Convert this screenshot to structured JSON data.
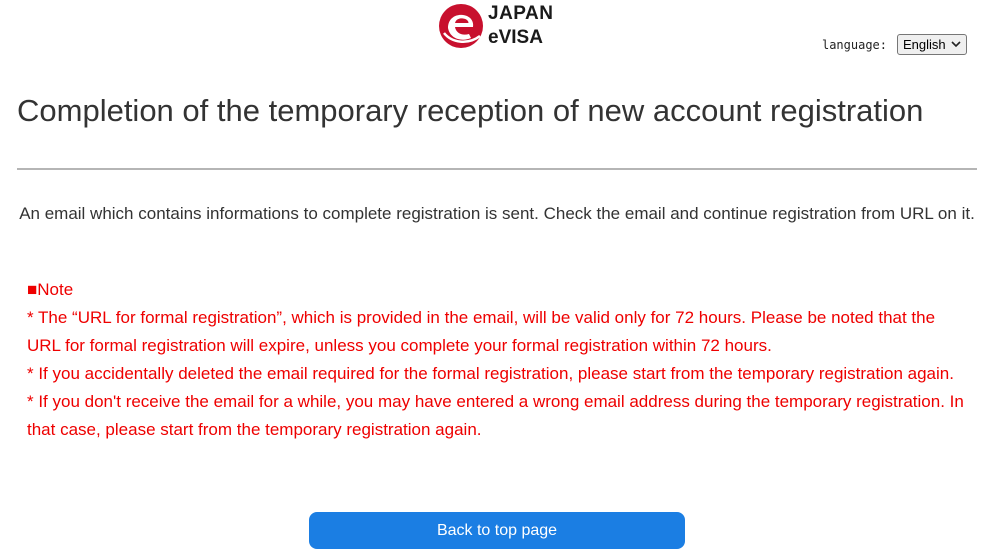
{
  "header": {
    "logo_line1": "JAPAN",
    "logo_line2": "eVISA",
    "logo_icon": "japan-evisa-logo-icon",
    "language_label": "language:",
    "language_selected": "English"
  },
  "main": {
    "title": "Completion of the temporary reception of new account registration",
    "message": "An email which contains informations to complete registration is sent. Check the email and continue registration from URL on it.",
    "note_heading": "■Note",
    "notes": [
      "* The “URL for formal registration”, which is provided in the email, will be valid only for 72 hours. Please be noted that the URL for formal registration will expire, unless you complete your formal registration within 72 hours.",
      "* If you accidentally deleted the email required for the formal registration, please start from the temporary registration again.",
      "* If you don't receive the email for a while, you may have entered a wrong email address during the temporary registration. In that case, please start from the temporary registration again."
    ],
    "back_button": "Back to top page"
  },
  "colors": {
    "brand_red": "#c8102e",
    "note_red": "#ee0000",
    "button_blue": "#1b7ee3",
    "title_gray": "#333333"
  }
}
